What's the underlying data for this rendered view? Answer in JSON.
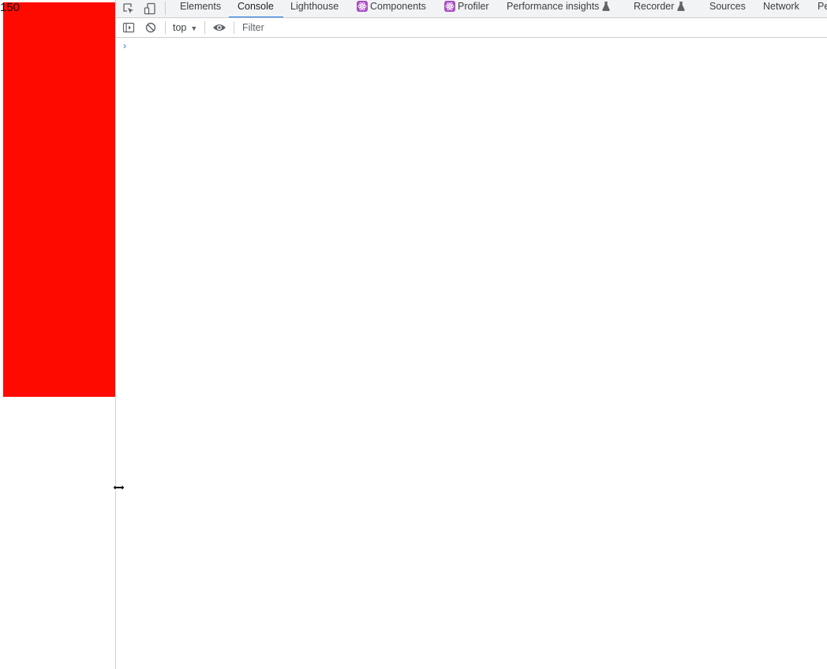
{
  "page": {
    "box_label": "150",
    "box_color": "#ff0a00"
  },
  "devtools": {
    "icons": {
      "inspect": "inspect-element-icon",
      "device": "device-toolbar-icon",
      "sidebar": "show-console-sidebar-icon",
      "clear": "clear-console-icon",
      "eye": "live-expression-eye-icon",
      "resize": "resize-cursor-icon"
    },
    "tabs": [
      {
        "label": "Elements"
      },
      {
        "label": "Console"
      },
      {
        "label": "Lighthouse"
      },
      {
        "label": "Components"
      },
      {
        "label": "Profiler"
      },
      {
        "label": "Performance insights"
      },
      {
        "label": "Recorder"
      },
      {
        "label": "Sources"
      },
      {
        "label": "Network"
      },
      {
        "label": "Pe"
      }
    ],
    "active_tab": "Console",
    "toolbar": {
      "context": "top",
      "filter_placeholder": "Filter"
    },
    "console": {
      "prompt_symbol": "›"
    },
    "colors": {
      "accent": "#1a73e8",
      "react_badge": "#a94fc2"
    }
  }
}
